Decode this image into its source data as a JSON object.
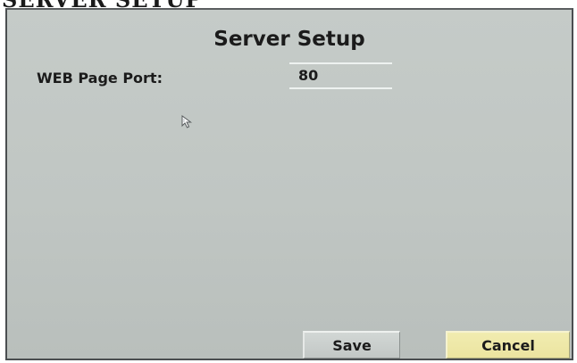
{
  "screen": {
    "top_title": "SERVER SETUP"
  },
  "dialog": {
    "title": "Server Setup",
    "fields": [
      {
        "label": "WEB Page Port:",
        "value": "80"
      }
    ],
    "buttons": {
      "save_label": "Save",
      "cancel_label": "Cancel"
    }
  },
  "colors": {
    "dialog_background": "#c2c8c5",
    "cancel_highlight": "#ede6a6",
    "text": "#1b1b1b"
  },
  "icons": {
    "cursor": "mouse-pointer-icon"
  }
}
